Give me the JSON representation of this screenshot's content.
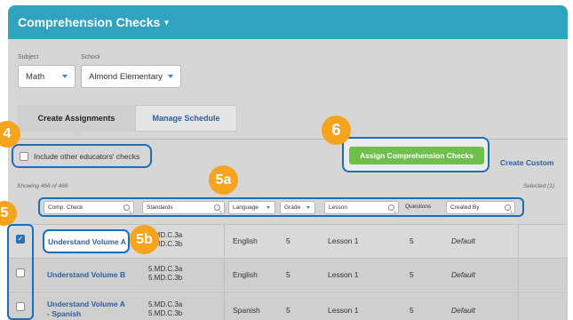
{
  "app": {
    "title": "Comprehension Checks",
    "title_caret": "▾"
  },
  "filters": {
    "subject_label": "Subject",
    "subject_value": "Math",
    "school_label": "School",
    "school_value": "Almond Elementary"
  },
  "tabs": [
    {
      "label": "Create Assignments",
      "active": true
    },
    {
      "label": "Manage Schedule",
      "active": false
    }
  ],
  "toolbar": {
    "include_label": "Include other educators' checks",
    "assign_label": "Assign Comprehension Checks",
    "create_custom_label": "Create Custom",
    "showing_text": "Showing 466 of 466",
    "selected_text": "Selected (1)"
  },
  "filter_bar": {
    "comp_check_placeholder": "Comp. Check",
    "standards_placeholder": "Standards",
    "language_label": "Language",
    "grade_label": "Grade",
    "lesson_placeholder": "Lesson",
    "questions_label": "Questions",
    "created_by_placeholder": "Created By"
  },
  "rows": [
    {
      "checked": true,
      "name": "Understand Volume A",
      "standards": [
        "5.MD.C.3a",
        "5.MD.C.3b"
      ],
      "language": "English",
      "grade": "5",
      "lesson": "Lesson 1",
      "questions": "5",
      "created_by": "Default"
    },
    {
      "checked": false,
      "name": "Understand Volume B",
      "standards": [
        "5.MD.C.3a",
        "5.MD.C.3b"
      ],
      "language": "English",
      "grade": "5",
      "lesson": "Lesson 1",
      "questions": "5",
      "created_by": "Default"
    },
    {
      "checked": false,
      "name_lines": [
        "Understand Volume A",
        "- Spanish"
      ],
      "standards": [
        "5.MD.C.3a",
        "5.MD.C.3b"
      ],
      "language": "Spanish",
      "grade": "5",
      "lesson": "Lesson 1",
      "questions": "5",
      "created_by": "Default"
    }
  ],
  "badges": {
    "b4": "4",
    "b5": "5",
    "b5a": "5a",
    "b5b": "5b",
    "b6": "6"
  },
  "icons": {
    "checkbox_checked": "✓"
  },
  "colors": {
    "header_teal": "#30a3c0",
    "callout_blue": "#1f6eb3",
    "badge_orange": "#f6a31e",
    "assign_green": "#6ebf4b",
    "link_blue": "#2f5f9c"
  }
}
